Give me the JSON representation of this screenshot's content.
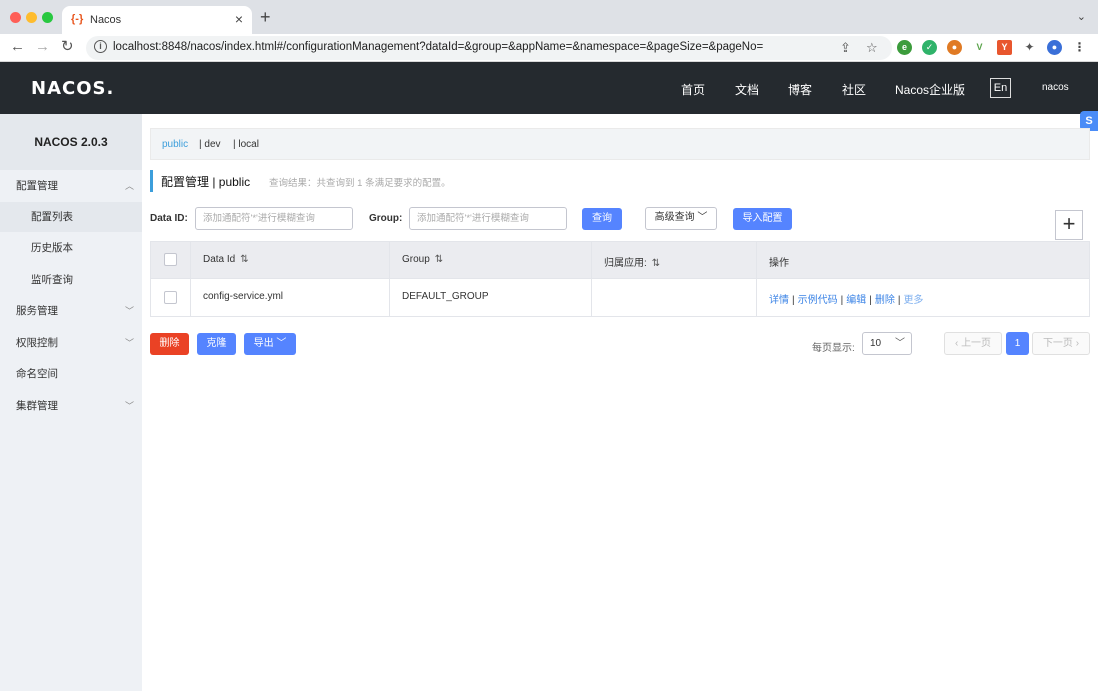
{
  "browser": {
    "tab_title": "Nacos",
    "tab_favicon": "{-}",
    "url": "localhost:8848/nacos/index.html#/configurationManagement?dataId=&group=&appName=&namespace=&pageSize=&pageNo="
  },
  "header": {
    "logo": "NACOS.",
    "nav": [
      "首页",
      "文档",
      "博客",
      "社区",
      "Nacos企业版"
    ],
    "lang": "En",
    "user": "nacos"
  },
  "sidebar": {
    "version": "NACOS 2.0.3",
    "items": [
      {
        "label": "配置管理"
      },
      {
        "label": "配置列表"
      },
      {
        "label": "历史版本"
      },
      {
        "label": "监听查询"
      },
      {
        "label": "服务管理"
      },
      {
        "label": "权限控制"
      },
      {
        "label": "命名空间"
      },
      {
        "label": "集群管理"
      }
    ]
  },
  "namespaces": [
    "public",
    "| dev",
    "| local"
  ],
  "page": {
    "title": "配置管理 | public",
    "query_result": "查询结果：共查询到 1 条满足要求的配置。"
  },
  "filters": {
    "dataid_label": "Data ID:",
    "dataid_placeholder": "添加通配符'*'进行模糊查询",
    "group_label": "Group:",
    "group_placeholder": "添加通配符'*'进行模糊查询",
    "query_btn": "查询",
    "advanced_btn": "高级查询",
    "import_btn": "导入配置",
    "add_btn": "+"
  },
  "table": {
    "headers": [
      "Data Id",
      "Group",
      "归属应用:",
      "操作"
    ],
    "rows": [
      {
        "dataid": "config-service.yml",
        "group": "DEFAULT_GROUP",
        "app": ""
      }
    ],
    "ops": [
      "详情",
      "示例代码",
      "编辑",
      "删除",
      "更多"
    ]
  },
  "bottom": {
    "delete_btn": "删除",
    "clone_btn": "克隆",
    "export_btn": "导出",
    "page_size_label": "每页显示:",
    "page_size": "10",
    "prev": "上一页",
    "current_page": "1",
    "next": "下一页"
  },
  "colors": {
    "header_bg": "#252a2f",
    "primary": "#5584ff",
    "danger": "#ea4225",
    "link": "#3c84e6",
    "accent": "#3c9edb"
  }
}
